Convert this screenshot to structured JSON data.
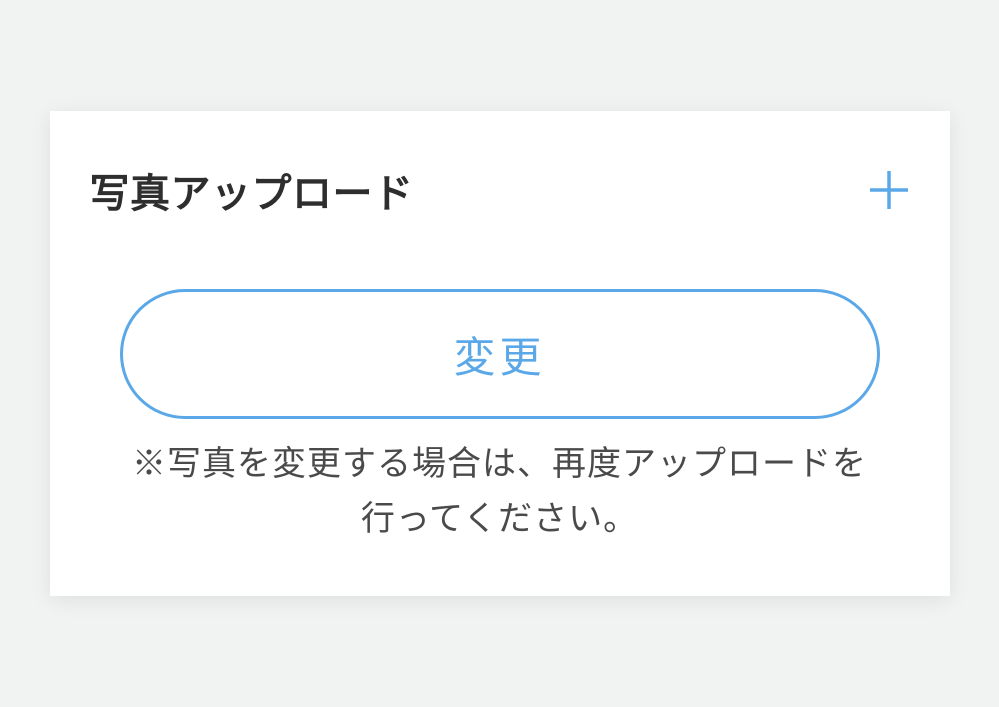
{
  "upload": {
    "title": "写真アップロード",
    "change_button_label": "変更",
    "help_text": "※写真を変更する場合は、再度アップロードを行ってください。"
  },
  "colors": {
    "accent": "#5ba8e8",
    "text_primary": "#2e2e2e",
    "text_secondary": "#4a4a4a",
    "background": "#f1f2f2",
    "card_background": "#ffffff"
  }
}
